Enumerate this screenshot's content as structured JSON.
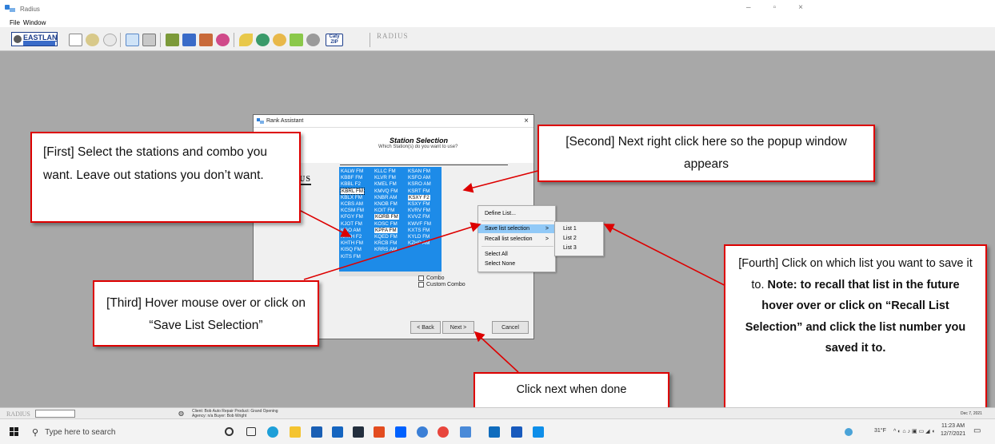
{
  "window": {
    "title": "Radius",
    "controls": [
      "–",
      "▫",
      "×"
    ]
  },
  "menu": {
    "file": "File",
    "window": "Window"
  },
  "toolbar": {
    "eastlan_label": "EASTLAN",
    "brand": "RADIUS",
    "caty_label": "Caty ZIP"
  },
  "dialog": {
    "title": "Rank Assistant",
    "close": "×",
    "heading": "Station Selection",
    "subheading": "Which Station(s) do you want to use?",
    "logo": "DIUS",
    "stations_col1": [
      "KALW FM",
      "KBBF FM",
      "KBBL F2",
      "KBRL FM",
      "KBLX FM",
      "KCBS AM",
      "KCSM FM",
      "KFGY FM",
      "KJOT FM",
      "KGO AM",
      "KHTH F2",
      "KHTH FM",
      "KISQ FM",
      "KITS FM"
    ],
    "stations_col2": [
      "KLLC FM",
      "KLVR FM",
      "KMEL FM",
      "KMVQ FM",
      "KNBR AM",
      "KNOB FM",
      "KOIT FM",
      "KORB FM",
      "KOSC FM",
      "KPFA FM",
      "KQED FM",
      "KRCB FM",
      "KRRS AM"
    ],
    "stations_col3": [
      "KSAN FM",
      "KSFO AM",
      "KSRO AM",
      "KSRT FM",
      "KSXY F2",
      "KSXY FM",
      "KVRV FM",
      "KVVZ FM",
      "KWVF FM",
      "KXTS FM",
      "KYLD FM",
      "KZHP AM"
    ],
    "combo": "Combo",
    "custom_combo": "Custom Combo",
    "back": "< Back",
    "next": "Next >",
    "cancel": "Cancel"
  },
  "context_menu": {
    "define": "Define List...",
    "save": "Save list selection",
    "recall": "Recall list selection",
    "select_all": "Select All",
    "select_none": "Select None",
    "arrow": ">"
  },
  "submenu": {
    "list1": "List 1",
    "list2": "List 2",
    "list3": "List 3"
  },
  "callouts": {
    "first": "[First] Select the stations and combo you want. Leave out stations you don’t want.",
    "second": "[Second] Next right click here so the popup window appears",
    "third": "[Third] Hover mouse over or click on “Save List Selection”",
    "fourth_pre": "[Fourth] Click on which list you want to save it to.",
    "fourth_bold": "Note: to recall that list in the future hover over or click on “Recall List Selection” and click the list number you saved it to.",
    "next": "Click next when done"
  },
  "statusbar": {
    "logo": "RADIUS",
    "client_line1": "Client: Bob Auto Repair   Product: Grand Opening",
    "client_line2": "Agency: n/a    Buyer: Bob Wright",
    "date": "Dec 7, 2021"
  },
  "taskbar": {
    "search_placeholder": "Type here to search",
    "weather": "31°F",
    "time": "11:23 AM",
    "date": "12/7/2021"
  },
  "colors": {
    "accent_red": "#d00000",
    "selection_blue": "#1d8be8",
    "menu_highlight": "#91c9f7"
  }
}
